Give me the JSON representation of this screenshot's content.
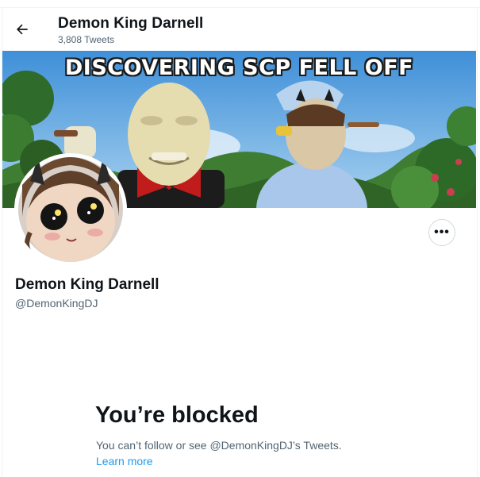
{
  "header": {
    "title": "Demon King Darnell",
    "tweet_count": "3,808 Tweets"
  },
  "banner": {
    "caption": "DISCOVERING SCP FELL OFF"
  },
  "profile": {
    "display_name": "Demon King Darnell",
    "handle": "@DemonKingDJ",
    "more_label": "•••"
  },
  "blocked": {
    "title": "You’re blocked",
    "description": "You can’t follow or see @DemonKingDJ’s Tweets.",
    "learn_more": "Learn more"
  },
  "colors": {
    "accent": "#1d9bf0",
    "secondary_text": "#536471",
    "primary_text": "#0f1419",
    "border": "#cfd9de"
  },
  "icons": [
    "back-arrow-icon",
    "more-options-icon"
  ]
}
